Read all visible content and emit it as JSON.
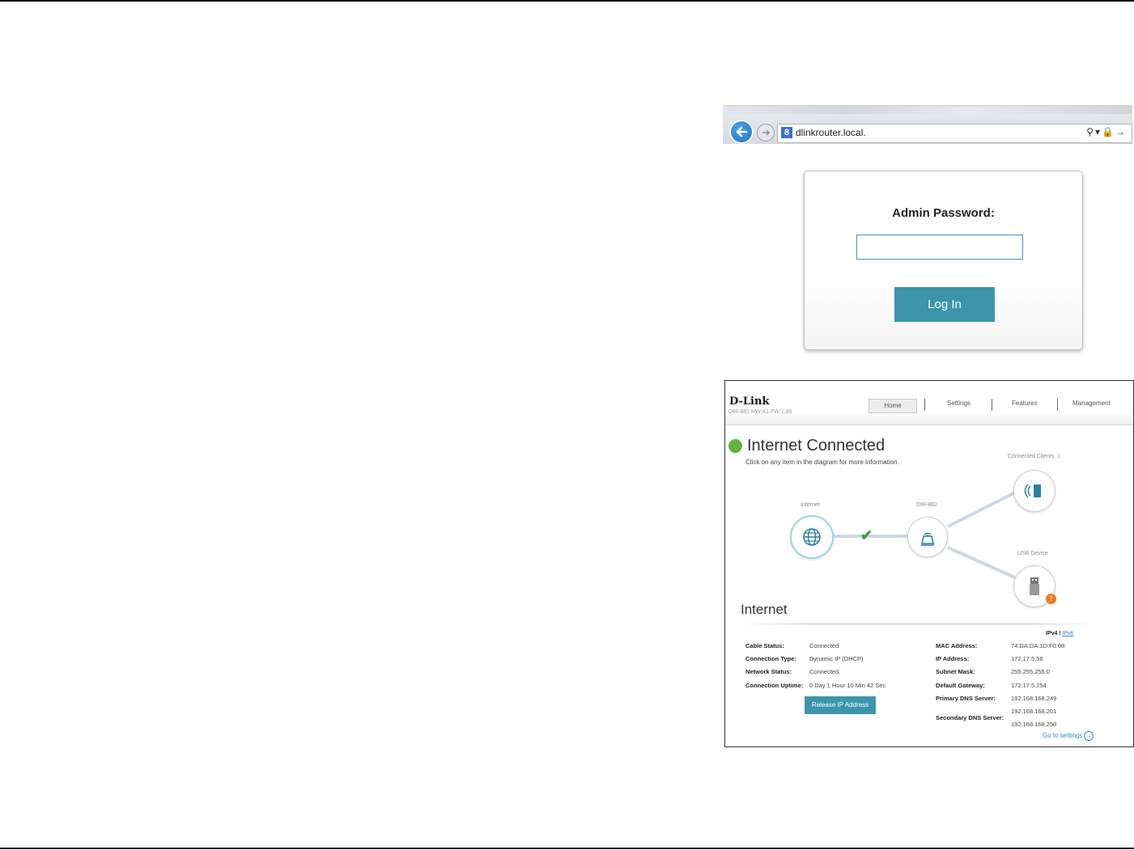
{
  "browser": {
    "url": "dlinkrouter.local.",
    "search_badge": "8"
  },
  "login": {
    "label": "Admin Password:",
    "password_value": "",
    "login_button": "Log In"
  },
  "router": {
    "logo": "D-Link",
    "model_info": "DIR-882 HW:A1 FW:1.00",
    "nav": [
      "Home",
      "Settings",
      "Features",
      "Management"
    ],
    "status_title": "Internet Connected",
    "status_subtitle": "Click on any item in the diagram for more information.",
    "status_color": "#62b33f",
    "diagram": {
      "internet_label": "Internet",
      "router_label": "DIR-882",
      "clients_label": "Connected Clients",
      "clients_count": "1",
      "usb_label": "USB Device",
      "alert_symbol": "!"
    },
    "section_title": "Internet",
    "ip_version": {
      "ipv4": "IPv4",
      "separator": "/",
      "ipv6": "IPv6"
    },
    "left_details": [
      {
        "key": "Cable Status:",
        "value": "Connected"
      },
      {
        "key": "Connection Type:",
        "value": "Dynamic IP (DHCP)"
      },
      {
        "key": "Network Status:",
        "value": "Connected"
      },
      {
        "key": "Connection Uptime:",
        "value": "0 Day 1 Hour 10 Min 42 Sec"
      }
    ],
    "right_details": [
      {
        "key": "MAC Address:",
        "value": "74:DA:DA:1D:F0:08"
      },
      {
        "key": "IP Address:",
        "value": "172.17.5.56"
      },
      {
        "key": "Subnet Mask:",
        "value": "255.255.255.0"
      },
      {
        "key": "Default Gateway:",
        "value": "172.17.5.254"
      },
      {
        "key": "Primary DNS Server:",
        "value": "192.168.168.249"
      }
    ],
    "secondary_dns": {
      "key": "Secondary DNS Server:",
      "value1": "192.168.168.201",
      "value2": "192.168.168.250"
    },
    "release_button": "Release IP Address",
    "go_to_settings": "Go to settings",
    "accent_color": "#3c95ab"
  }
}
